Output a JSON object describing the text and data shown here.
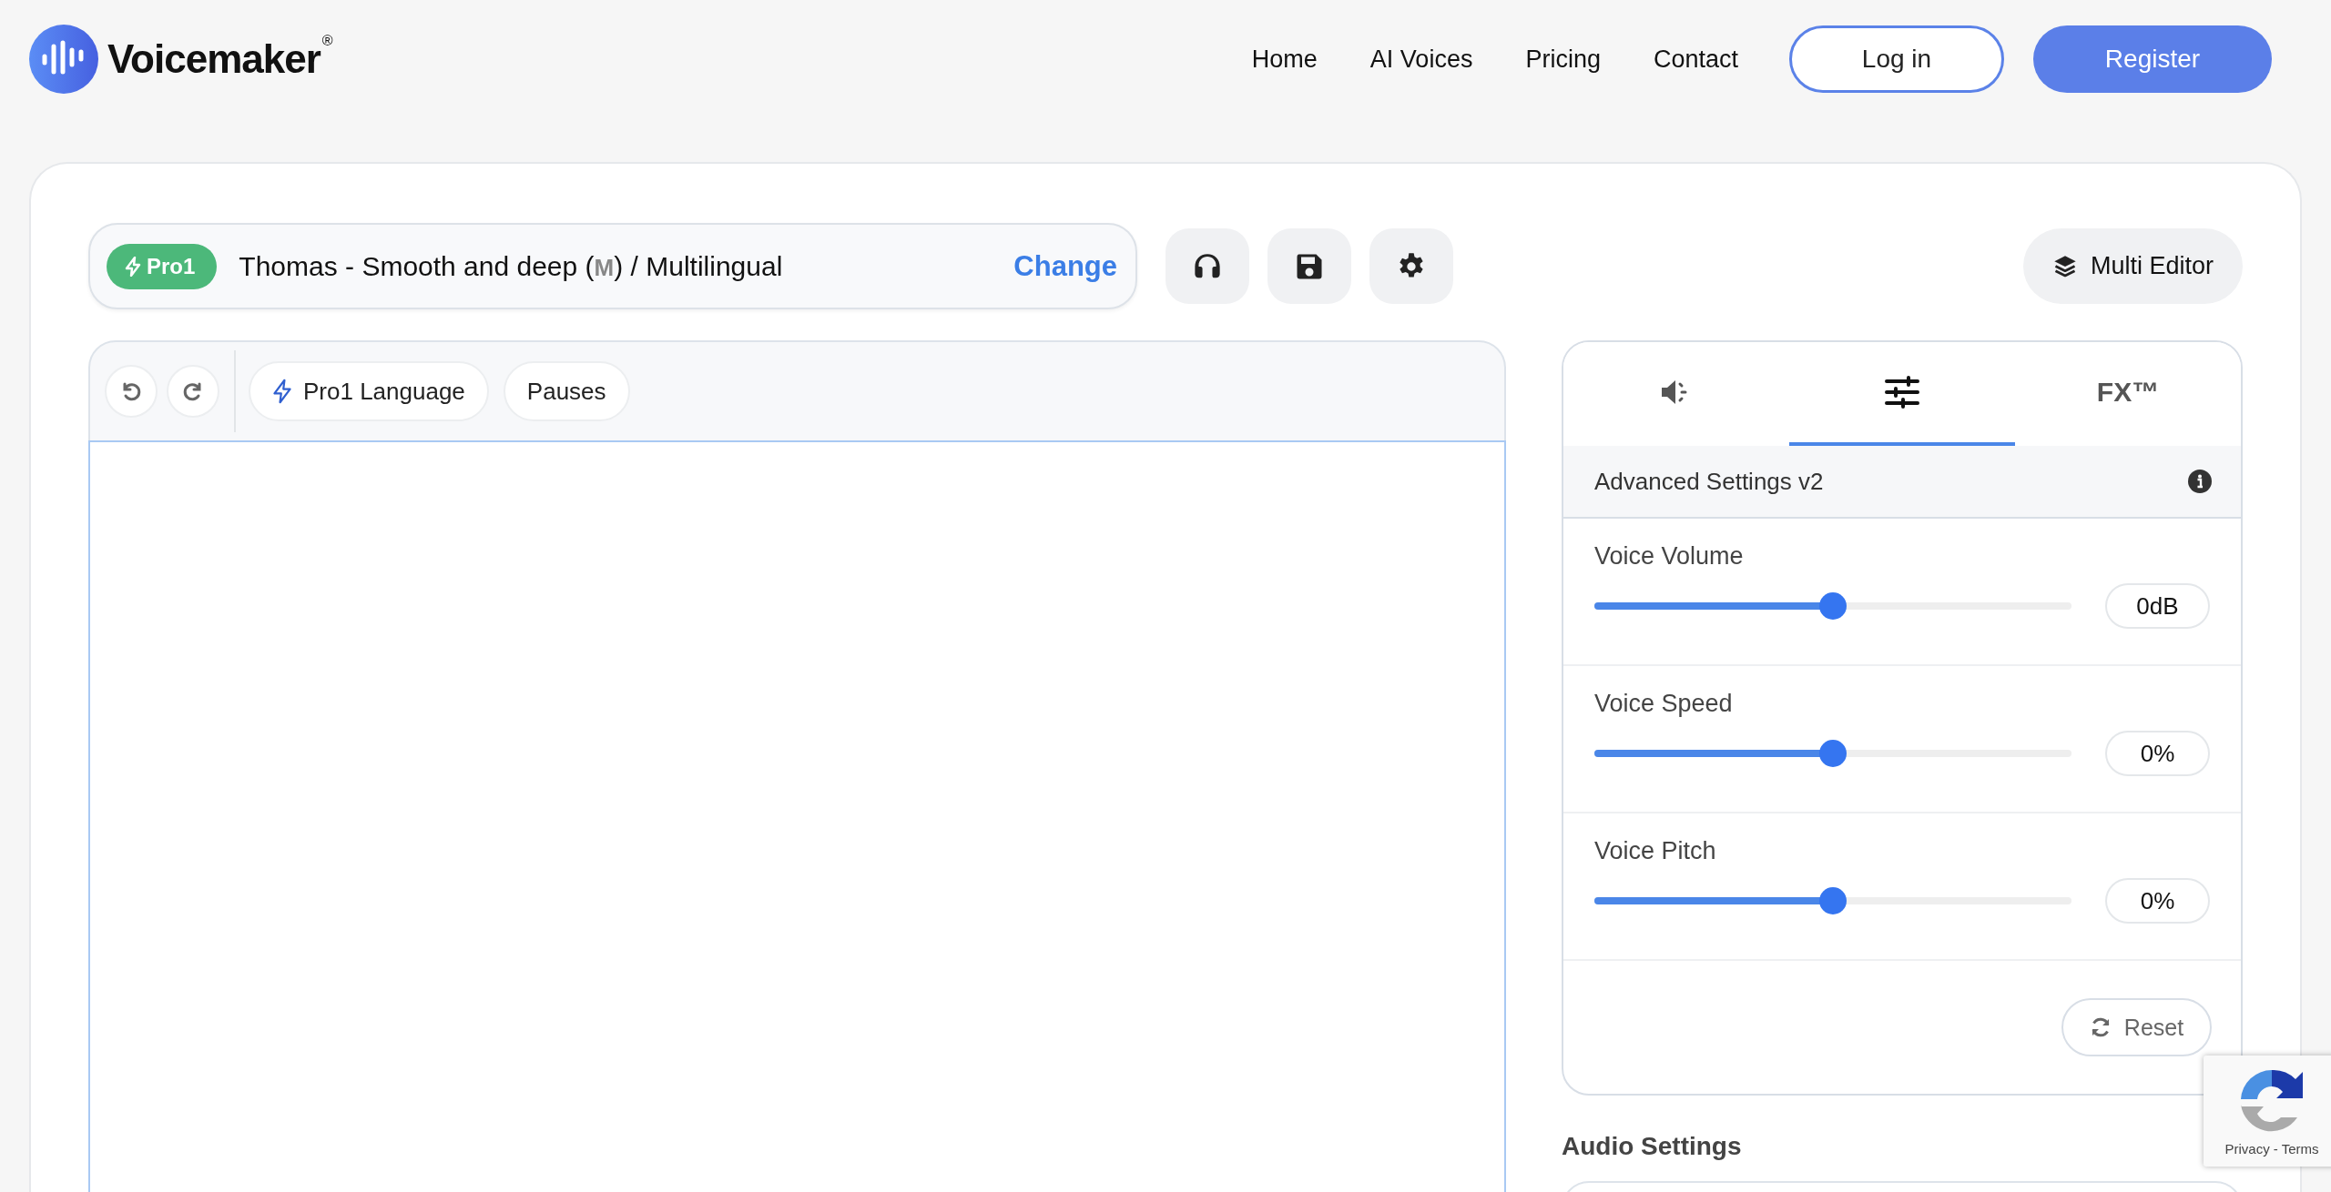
{
  "brand": {
    "name": "Voicemaker",
    "mark": "®"
  },
  "nav": [
    {
      "label": "Home"
    },
    {
      "label": "AI Voices"
    },
    {
      "label": "Pricing"
    },
    {
      "label": "Contact"
    }
  ],
  "auth": [
    {
      "label": "Log in",
      "kind": "outline"
    },
    {
      "label": "Register",
      "kind": "filled"
    }
  ],
  "voice": {
    "badge": "Pro1",
    "name": "Thomas - Smooth and deep (**M**) / Multilingual",
    "action": "Change"
  },
  "tool_buttons": [
    {
      "kind": "headphones"
    },
    {
      "kind": "save"
    },
    {
      "kind": "settings"
    }
  ],
  "multi_editor": "Multi Editor",
  "editor": {
    "history": [
      {
        "kind": "undo"
      },
      {
        "kind": "redo"
      }
    ],
    "chips": [
      {
        "label": "Pro1 Language",
        "kind": "pro"
      },
      {
        "label": "Pauses",
        "kind": "plain"
      }
    ]
  },
  "panel": {
    "tabs": [
      {
        "kind": "speaker",
        "selected": false
      },
      {
        "kind": "sliders",
        "selected": true
      },
      {
        "kind": "text",
        "label": "FX™",
        "selected": false
      }
    ],
    "title": "Advanced Settings v2",
    "sliders": [
      {
        "label": "Voice Volume",
        "level": 0.5,
        "reading": "0dB"
      },
      {
        "label": "Voice Speed",
        "level": 0.5,
        "reading": "0%"
      },
      {
        "label": "Voice Pitch",
        "level": 0.5,
        "reading": "0%"
      }
    ],
    "reset": "Reset"
  },
  "audio_settings": {
    "title": "Audio Settings"
  },
  "recaptcha": {
    "text": "Privacy - Terms"
  }
}
